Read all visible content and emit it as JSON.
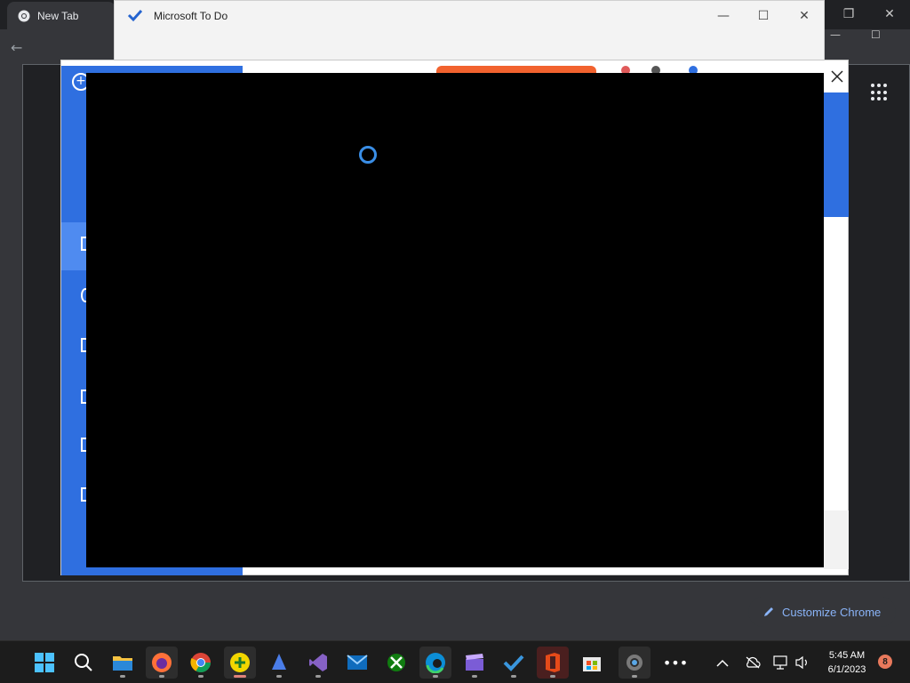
{
  "chrome": {
    "tab_title": "New Tab",
    "customize_label": "Customize Chrome"
  },
  "todo": {
    "title": "Microsoft To Do"
  },
  "taskbar": {
    "time": "5:45 AM",
    "date": "6/1/2023",
    "notification_count": "8",
    "apps": [
      "windows-start",
      "search",
      "file-explorer",
      "firefox",
      "chrome",
      "app-plus",
      "app-sail",
      "visual-studio",
      "mail",
      "xbox",
      "edge",
      "clipchamp",
      "todo",
      "office",
      "store",
      "settings",
      "more"
    ]
  },
  "colors": {
    "app_blue": "#2f6fe0",
    "spinner": "#3a8ee6",
    "chrome_accent": "#8ab4f8"
  }
}
